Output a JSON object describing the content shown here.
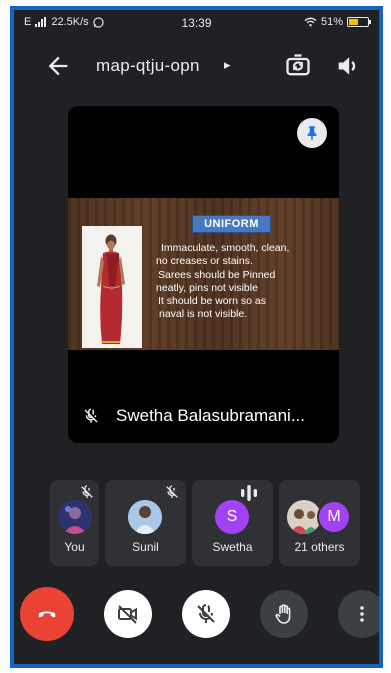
{
  "status_bar": {
    "network": "E",
    "speed": "22.5K/s",
    "time": "13:39",
    "battery": "51%",
    "battery_level": 0.51
  },
  "header": {
    "meeting_code": "map-qtju-opn",
    "caret": "▸",
    "icons": [
      "back-arrow-icon",
      "switch-camera-icon",
      "speaker-icon"
    ]
  },
  "main_tile": {
    "presenter_name": "Swetha Balasubramani...",
    "slide": {
      "heading": "UNIFORM",
      "lines": [
        "Immaculate, smooth, clean,",
        "no creases or stains.",
        "Sarees should be Pinned",
        "neatly, pins not visible",
        "It should be worn so as",
        "naval is not visible."
      ]
    }
  },
  "participants": [
    {
      "label": "You",
      "mic_muted": true
    },
    {
      "label": "Sunil",
      "mic_muted": true
    },
    {
      "label": "Swetha",
      "initial": "S",
      "speaking": true,
      "avatar_color": "#a142f4"
    },
    {
      "label": "21 others",
      "initial": "M",
      "avatar_color": "#a142f4"
    }
  ],
  "controls": {
    "buttons": [
      "end-call",
      "camera-off",
      "mic-off",
      "raise-hand",
      "more-options"
    ],
    "colors": {
      "end_call": "#ea4335",
      "active": "#ffffff",
      "inactive": "#3c4043"
    }
  }
}
